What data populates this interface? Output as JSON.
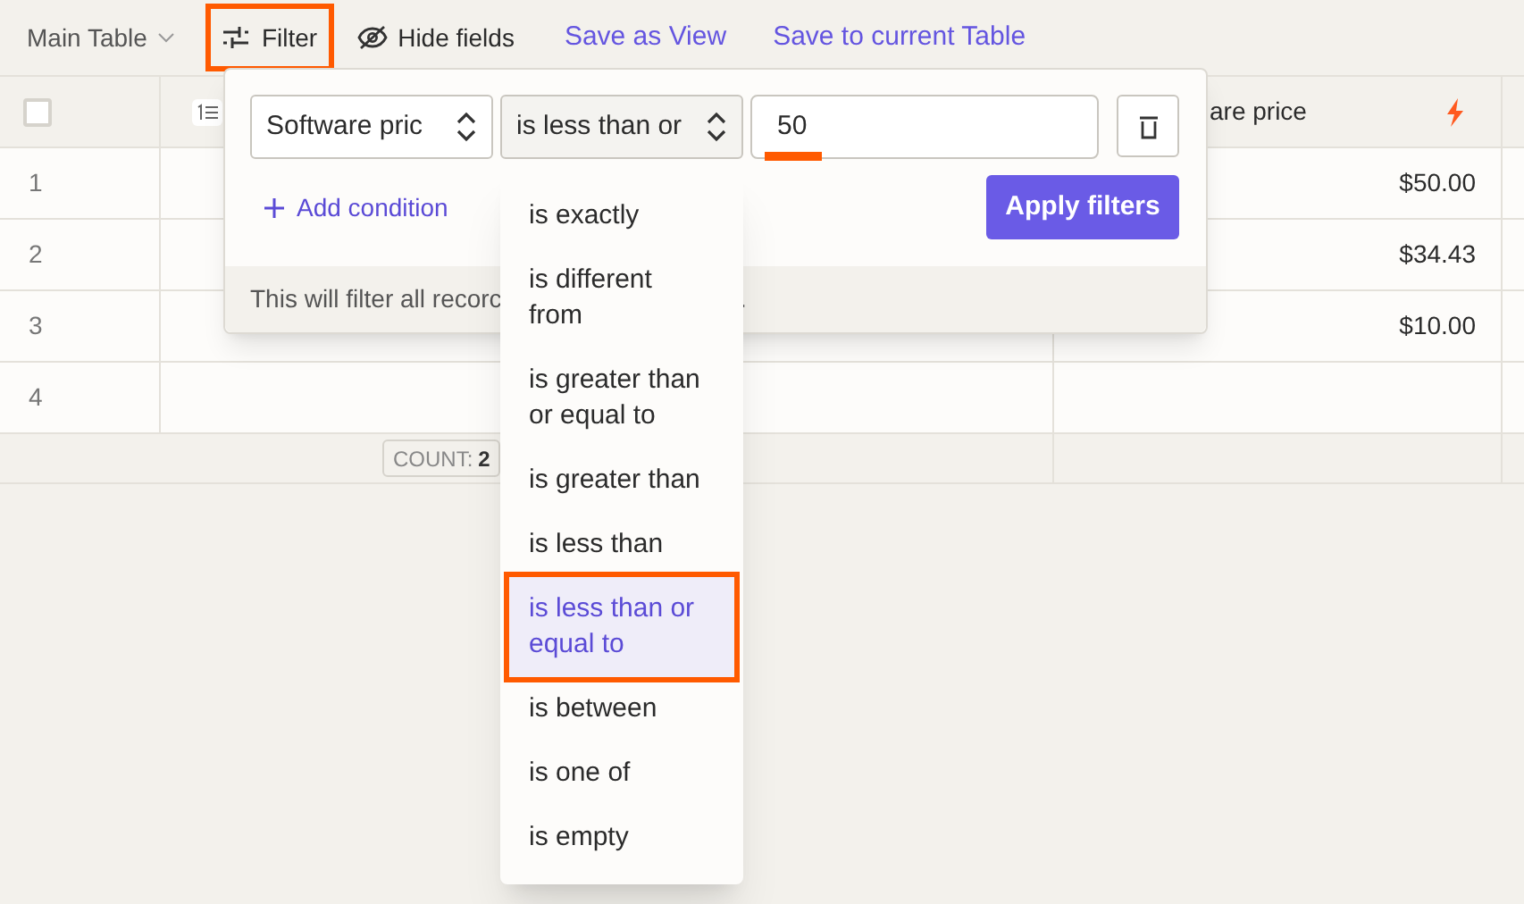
{
  "toolbar": {
    "view": "Main Table",
    "items": [
      {
        "kind": "filter",
        "label": "Filter",
        "highlighted": true
      },
      {
        "kind": "hide",
        "label": "Hide fields",
        "highlighted": false
      }
    ],
    "links": [
      "Save as View",
      "Save to current Table"
    ]
  },
  "table": {
    "columns": [
      {
        "kind": "check",
        "checked": false
      },
      {
        "kind": "number"
      },
      {
        "kind": "price",
        "label": "are price"
      }
    ],
    "rows": [
      {
        "number": "1",
        "price": "$50.00"
      },
      {
        "number": "2",
        "price": "$34.43"
      },
      {
        "number": "3",
        "price": "$10.00"
      },
      {
        "number": "4",
        "price": ""
      }
    ],
    "footer": {
      "count_label": "COUNT:",
      "count": "2"
    }
  },
  "filter_popup": {
    "field": "Software pric",
    "operator": "is less than or",
    "value": "50",
    "add_condition": "Add condition",
    "apply": "Apply filters",
    "note": "This will filter all recorc",
    "note_end": "."
  },
  "operator_menu": [
    {
      "label": "is exactly",
      "selected": false
    },
    {
      "label": "is different from",
      "selected": false
    },
    {
      "label": "is greater than or equal to",
      "selected": false
    },
    {
      "label": "is greater than",
      "selected": false
    },
    {
      "label": "is less than",
      "selected": false
    },
    {
      "label": "is less than or equal to",
      "selected": true
    },
    {
      "label": "is between",
      "selected": false
    },
    {
      "label": "is one of",
      "selected": false
    },
    {
      "label": "is empty",
      "selected": false
    }
  ]
}
